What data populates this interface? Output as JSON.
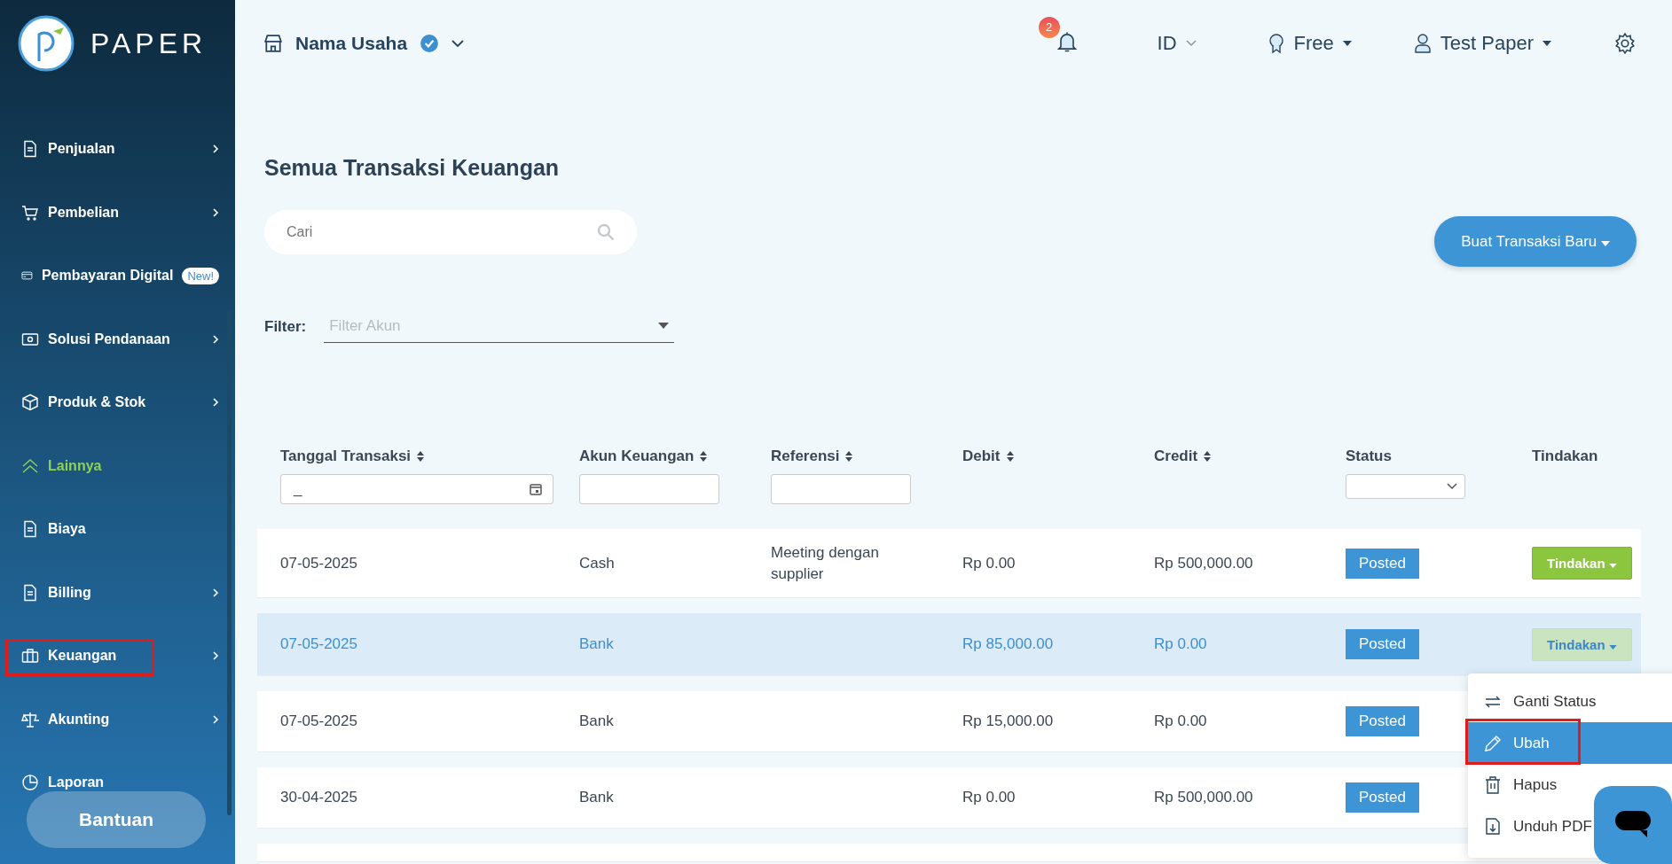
{
  "sidebar": {
    "logo_text": "PAPER",
    "items": [
      {
        "label": "Penjualan",
        "submenu": true,
        "active": false,
        "highlighted": false
      },
      {
        "label": "Pembelian",
        "submenu": true,
        "active": false,
        "highlighted": false
      },
      {
        "label": "Pembayaran Digital",
        "badge": "New!",
        "active": false,
        "highlighted": false
      },
      {
        "label": "Solusi Pendanaan",
        "submenu": true,
        "active": false,
        "highlighted": false
      },
      {
        "label": "Produk & Stok",
        "submenu": true,
        "active": false,
        "highlighted": false
      },
      {
        "label": "Lainnya",
        "submenu": false,
        "active": true,
        "highlighted": false
      },
      {
        "label": "Biaya",
        "submenu": false,
        "active": false,
        "highlighted": false
      },
      {
        "label": "Billing",
        "submenu": true,
        "active": false,
        "highlighted": false
      },
      {
        "label": "Keuangan",
        "submenu": true,
        "active": false,
        "highlighted": true
      },
      {
        "label": "Akunting",
        "submenu": true,
        "active": false,
        "highlighted": false
      },
      {
        "label": "Laporan",
        "submenu": false,
        "active": false,
        "highlighted": false
      }
    ],
    "help_button": "Bantuan"
  },
  "header": {
    "business": "Nama Usaha",
    "verified": true,
    "notifications": "2",
    "language": "ID",
    "plan": "Free",
    "user": "Test Paper"
  },
  "page": {
    "title": "Semua Transaksi Keuangan",
    "search": {
      "placeholder": "Cari"
    },
    "new_button": "Buat Transaksi Baru",
    "filter_label": "Filter:",
    "filter": {
      "placeholder": "Filter Akun"
    }
  },
  "table": {
    "columns": [
      {
        "label": "Tanggal Transaksi",
        "filter_value": "_"
      },
      {
        "label": "Akun Keuangan"
      },
      {
        "label": "Referensi"
      },
      {
        "label": "Debit"
      },
      {
        "label": "Credit"
      },
      {
        "label": "Status"
      },
      {
        "label": "Tindakan"
      }
    ],
    "rows": [
      {
        "date": "07-05-2025",
        "account": "Cash",
        "reference": "Meeting dengan supplier",
        "debit": "Rp 0.00",
        "credit": "Rp 500,000.00",
        "status": "Posted",
        "action": "Tindakan",
        "selected": false
      },
      {
        "date": "07-05-2025",
        "account": "Bank",
        "debit": "Rp 85,000.00",
        "credit": "Rp 0.00",
        "status": "Posted",
        "action": "Tindakan",
        "selected": true
      },
      {
        "date": "07-05-2025",
        "account": "Bank",
        "debit": "Rp 15,000.00",
        "credit": "Rp 0.00",
        "status": "Posted",
        "selected": false
      },
      {
        "date": "30-04-2025",
        "account": "Bank",
        "debit": "Rp 0.00",
        "credit": "Rp 500,000.00",
        "status": "Posted",
        "selected": false
      }
    ]
  },
  "action_menu": [
    {
      "label": "Ganti Status",
      "selected": false,
      "highlighted": false
    },
    {
      "label": "Ubah",
      "selected": true,
      "highlighted": true
    },
    {
      "label": "Hapus",
      "selected": false,
      "highlighted": false
    },
    {
      "label": "Unduh PDF",
      "selected": false,
      "highlighted": false
    }
  ]
}
